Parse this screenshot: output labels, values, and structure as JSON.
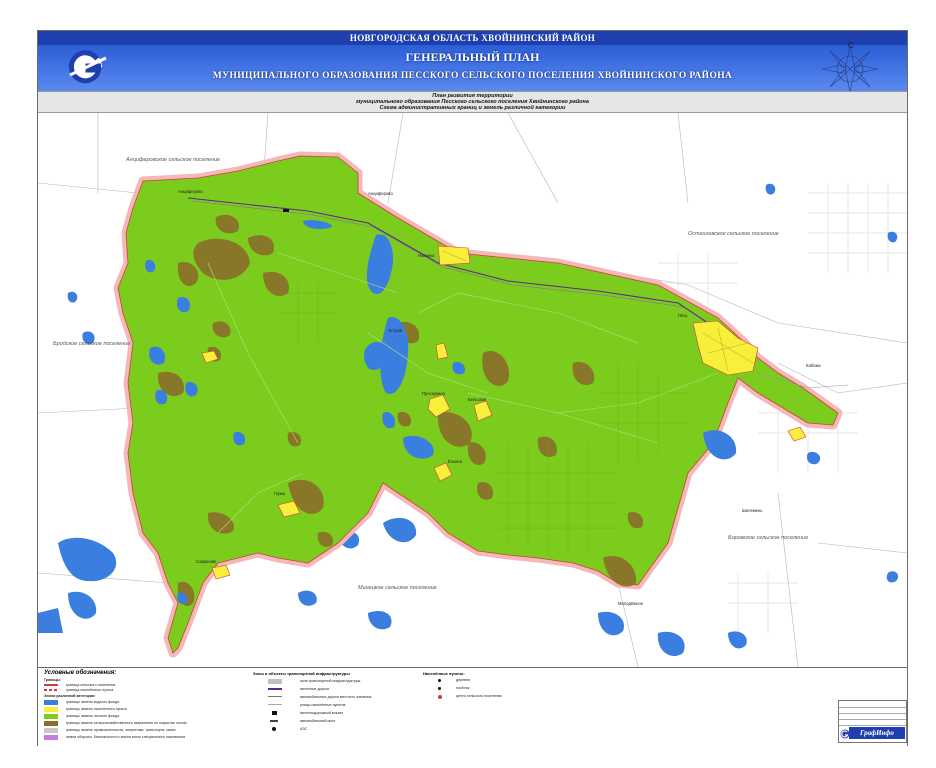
{
  "header": {
    "region": "НОВГОРОДСКАЯ ОБЛАСТЬ ХВОЙНИНСКИЙ РАЙОН",
    "title": "ГЕНЕРАЛЬНЫЙ ПЛАН",
    "subtitle": "МУНИЦИПАЛЬНОГО ОБРАЗОВАНИЯ ПЕССКОГО СЕЛЬСКОГО ПОСЕЛЕНИЯ ХВОЙНИНСКОГО РАЙОНА",
    "compass_letter": "С"
  },
  "scheme": {
    "line1": "План развития территории",
    "line2": "муниципального образования Песского сельского поселения Хвойнинского района",
    "line3": "Схема административных границ и земель различной категории"
  },
  "map": {
    "neighbors": [
      "Анциферовское сельское поселение",
      "Остахновское сельское поселение",
      "Бродское сельское поселение",
      "Боровское сельское поселение",
      "Минецкое сельское поселение"
    ],
    "places": [
      "Анциферово",
      "Анциферово",
      "Песь",
      "Кабожа",
      "Шелемень",
      "Остров",
      "Горка",
      "Сафоново",
      "Молодёжное",
      "Новинка",
      "Ёлкино",
      "Проскурино",
      "Бельская"
    ],
    "colors": {
      "territory": "#7ccc1e",
      "forest_patch": "#8a6e2a",
      "settlement": "#f7ef3a",
      "water": "#3a7fe0",
      "boundary_glow": "#f5b8b8",
      "boundary_line": "#d23b3b"
    }
  },
  "legend": {
    "title": "Условные обозначения:",
    "col1": [
      "Границы:",
      "граница сельского поселения",
      "граница населённого пункта",
      "Земли различной категории:",
      "границы земель водного фонда",
      "границы земель населенного пункта",
      "границы земель лесного фонда",
      "границы земель сельскохозяйственного назначения не покрытых лесом",
      "границы земель промышленности, энергетики, транспорта, связи",
      "земли обороны, безопасности и земли иного специального назначения"
    ],
    "col2_title": "Зоны и объекты транспортной инфраструктуры",
    "col2": [
      "зона транспортной инфраструктуры",
      "железные дороги",
      "автомобильные дороги местного значения",
      "улицы населённых пунктов",
      "железнодорожный вокзал",
      "автомобильный мост",
      "АЗС"
    ],
    "col3_title": "Населённые пункты:",
    "col3": [
      "деревня",
      "посёлок",
      "центр сельского поселения"
    ],
    "brand": "ГрафИнфо"
  }
}
